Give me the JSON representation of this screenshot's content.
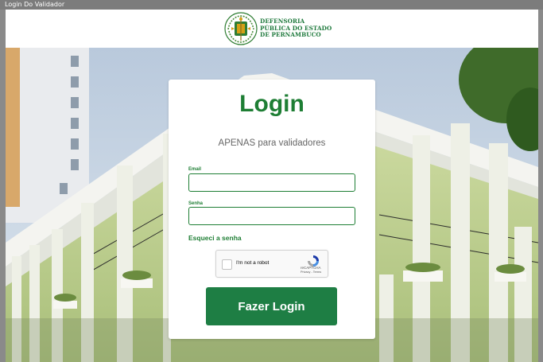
{
  "window": {
    "title": "Login Do Validador"
  },
  "header": {
    "brand_line1": "DEFENSORIA",
    "brand_line2": "PÚBLICA DO ESTADO",
    "brand_line3": "DE PERNAMBUCO"
  },
  "card": {
    "title": "Login",
    "subtitle": "APENAS para validadores",
    "email_label": "Email",
    "email_value": "",
    "password_label": "Senha",
    "password_value": "",
    "forgot_link": "Esqueci a senha",
    "captcha": {
      "label": "I'm not a robot",
      "brand": "reCAPTCHA",
      "privacy": "Privacy",
      "terms": "Terms",
      "checked": false
    },
    "submit_label": "Fazer Login"
  },
  "colors": {
    "brand_green": "#1e7e34",
    "button_green": "#1e7e44",
    "header_bg": "#ffffff",
    "window_bar": "#7c7c7c"
  }
}
